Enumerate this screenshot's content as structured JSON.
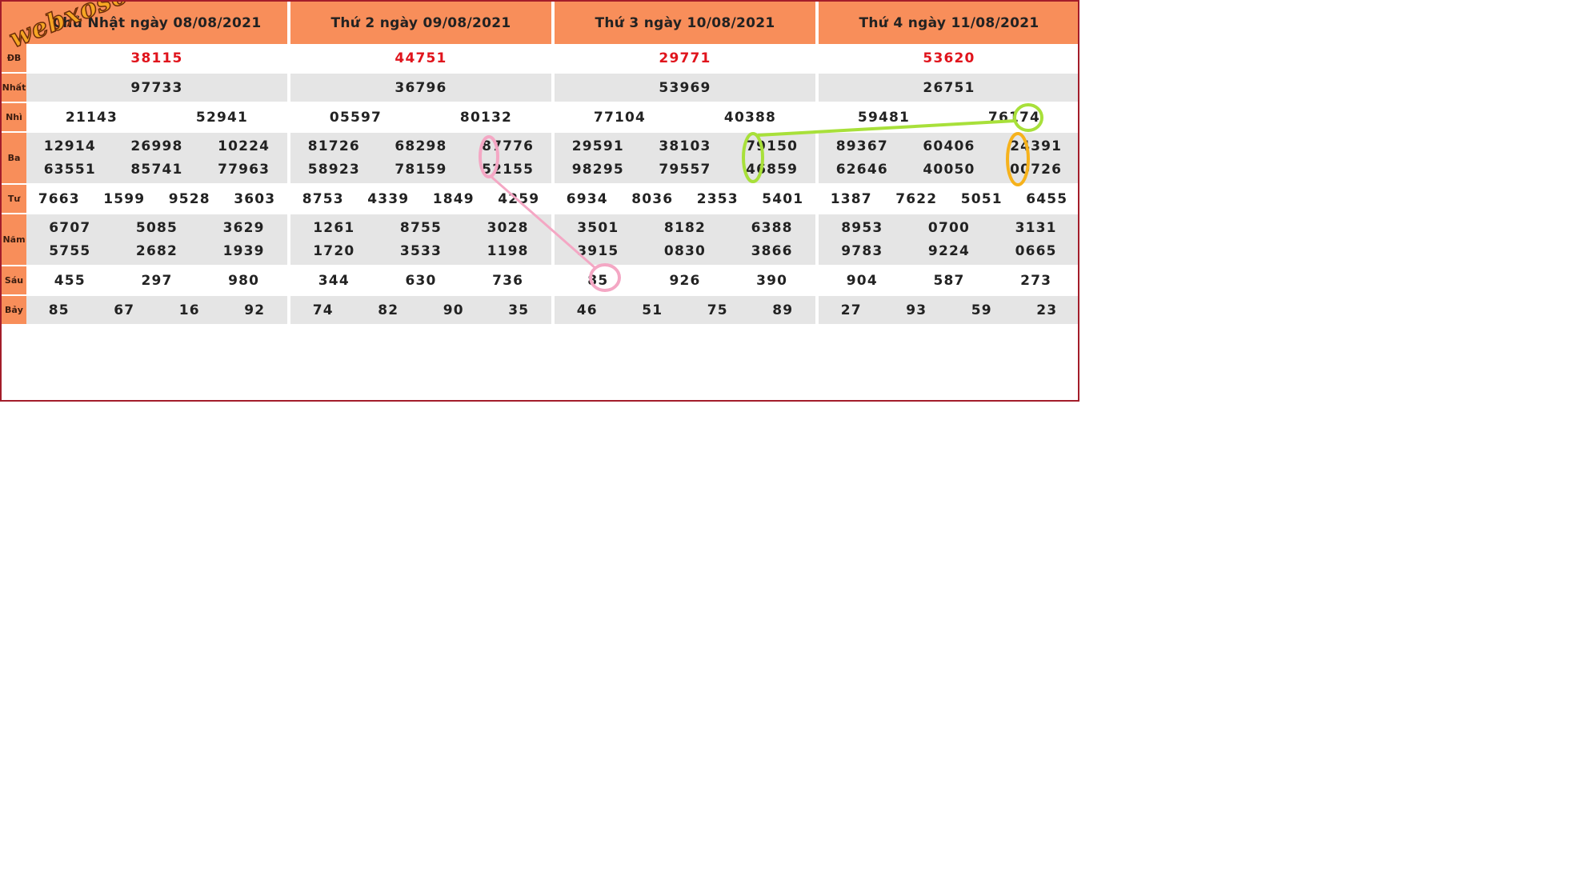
{
  "watermark": "webxoso.net",
  "labels": [
    "ĐB",
    "Nhất",
    "Nhì",
    "Ba",
    "Tư",
    "Năm",
    "Sáu",
    "Bảy"
  ],
  "days": [
    {
      "title": "Chủ Nhật ngày 08/08/2021",
      "rows": [
        [
          "38115"
        ],
        [
          "97733"
        ],
        [
          "21143",
          "52941"
        ],
        [
          "12914",
          "26998",
          "10224",
          "63551",
          "85741",
          "77963"
        ],
        [
          "7663",
          "1599",
          "9528",
          "3603"
        ],
        [
          "6707",
          "5085",
          "3629",
          "5755",
          "2682",
          "1939"
        ],
        [
          "455",
          "297",
          "980"
        ],
        [
          "85",
          "67",
          "16",
          "92"
        ]
      ]
    },
    {
      "title": "Thứ 2 ngày 09/08/2021",
      "rows": [
        [
          "44751"
        ],
        [
          "36796"
        ],
        [
          "05597",
          "80132"
        ],
        [
          "81726",
          "68298",
          "87776",
          "58923",
          "78159",
          "52155"
        ],
        [
          "8753",
          "4339",
          "1849",
          "4259"
        ],
        [
          "1261",
          "8755",
          "3028",
          "1720",
          "3533",
          "1198"
        ],
        [
          "344",
          "630",
          "736"
        ],
        [
          "74",
          "82",
          "90",
          "35"
        ]
      ]
    },
    {
      "title": "Thứ 3 ngày 10/08/2021",
      "rows": [
        [
          "29771"
        ],
        [
          "53969"
        ],
        [
          "77104",
          "40388"
        ],
        [
          "29591",
          "38103",
          "79150",
          "98295",
          "79557",
          "46859"
        ],
        [
          "6934",
          "8036",
          "2353",
          "5401"
        ],
        [
          "3501",
          "8182",
          "6388",
          "3915",
          "0830",
          "3866"
        ],
        [
          "85",
          "926",
          "390"
        ],
        [
          "46",
          "51",
          "75",
          "89"
        ]
      ]
    },
    {
      "title": "Thứ 4 ngày 11/08/2021",
      "rows": [
        [
          "53620"
        ],
        [
          "26751"
        ],
        [
          "59481",
          "76174"
        ],
        [
          "89367",
          "60406",
          "24391",
          "62646",
          "40050",
          "00726"
        ],
        [
          "1387",
          "7622",
          "5051",
          "6455"
        ],
        [
          "8953",
          "0700",
          "3131",
          "9783",
          "9224",
          "0665"
        ],
        [
          "904",
          "587",
          "273"
        ],
        [
          "27",
          "93",
          "59",
          "23"
        ]
      ]
    }
  ],
  "annotation_colors": {
    "pink": "#f4a7c4",
    "green": "#a8e03a",
    "orange": "#f6b21c"
  },
  "colors": {
    "header": "#f88e5a",
    "border": "#a31d2a",
    "special": "#e0141c",
    "stripe": "#e5e5e5"
  }
}
